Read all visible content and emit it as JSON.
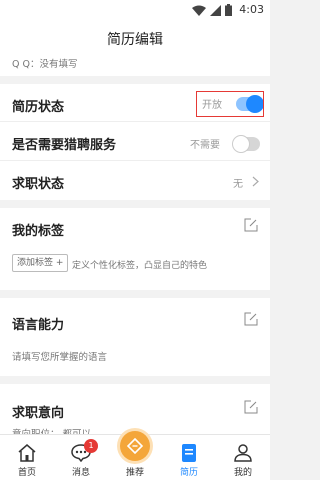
{
  "status_bar": {
    "time": "4:03"
  },
  "header": {
    "title": "简历编辑"
  },
  "contact": {
    "qq_text": "Q Q：没有填写"
  },
  "settings": {
    "resume_status": {
      "label": "简历状态",
      "value": "开放",
      "toggle_on": true
    },
    "headhunter": {
      "label": "是否需要猎聘服务",
      "value": "不需要",
      "toggle_on": false
    },
    "job_status": {
      "label": "求职状态",
      "value": "无"
    }
  },
  "tags_section": {
    "title": "我的标签",
    "add_button": "添加标签 +",
    "hint": "定义个性化标签，凸显自己的特色"
  },
  "language_section": {
    "title": "语言能力",
    "hint": "请填写您所掌握的语言"
  },
  "intent_section": {
    "title": "求职意向",
    "position_text": "意向职位： 都可以"
  },
  "tabbar": {
    "items": [
      {
        "label": "首页"
      },
      {
        "label": "消息",
        "badge": "1"
      },
      {
        "label": "推荐"
      },
      {
        "label": "简历",
        "active": true
      },
      {
        "label": "我的"
      }
    ]
  },
  "colors": {
    "accent": "#1e88ff",
    "highlight_box": "#e53935",
    "recommend": "#f4a63a"
  }
}
